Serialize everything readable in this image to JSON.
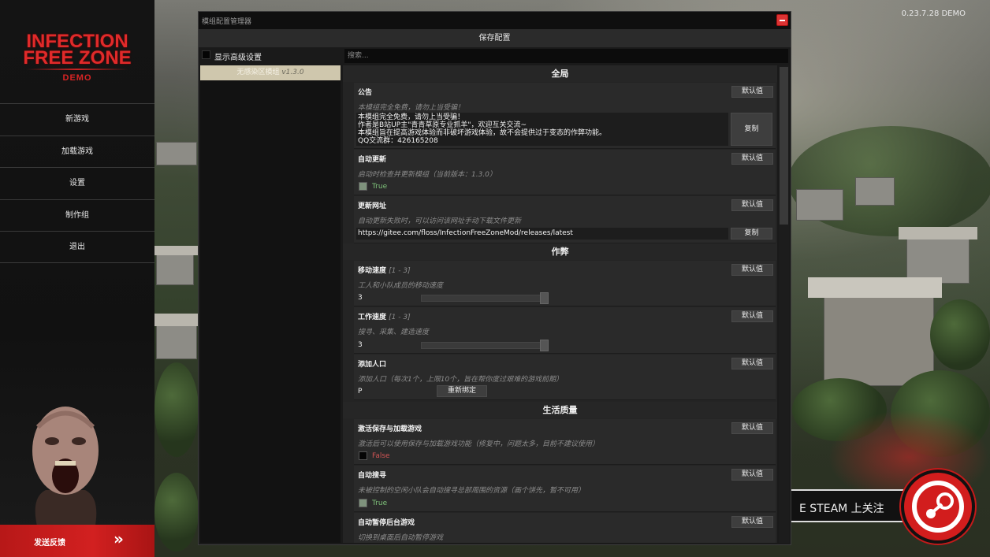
{
  "version": "0.23.7.28 DEMO",
  "logo": {
    "line1": "INFECTION",
    "line2": "FREE ZONE",
    "demo": "DEMO"
  },
  "menu": [
    "新游戏",
    "加载游戏",
    "设置",
    "制作组",
    "退出"
  ],
  "feedback": {
    "label": "发送反馈",
    "arrow": "»"
  },
  "steam": {
    "text": "E STEAM 上关注"
  },
  "window": {
    "title": "模组配置管理器",
    "save_label": "保存配置",
    "show_advanced": "显示高级设置",
    "search_placeholder": "搜索...",
    "mod": {
      "name": "无感染区模组",
      "version": "v1.3.0"
    }
  },
  "sections": {
    "global": "全局",
    "cheats": "作弊",
    "qol": "生活质量"
  },
  "labels": {
    "default": "默认值",
    "copy": "复制",
    "rebind": "重新绑定"
  },
  "settings": {
    "notice": {
      "title": "公告",
      "desc": "本模组完全免费，请勿上当受骗！",
      "text": "本模组完全免费，请勿上当受骗！\n作者是B站UP主\"青青草原专业抓羊\"，欢迎互关交流~\n本模组旨在提高游戏体验而非破坏游戏体验，故不会提供过于变态的作弊功能。\nQQ交流群：426165208"
    },
    "auto_update": {
      "title": "自动更新",
      "desc": "启动时检查并更新模组（当前版本：1.3.0）",
      "value": "True"
    },
    "update_url": {
      "title": "更新网址",
      "desc": "自动更新失败时，可以访问该网址手动下载文件更新",
      "value": "https://gitee.com/floss/InfectionFreeZoneMod/releases/latest"
    },
    "move_speed": {
      "title": "移动速度",
      "range": "[1 - 3]",
      "desc": "工人和小队成员的移动速度",
      "value": "3",
      "level": 1.0
    },
    "work_speed": {
      "title": "工作速度",
      "range": "[1 - 3]",
      "desc": "搜寻、采集、建造速度",
      "value": "3",
      "level": 1.0
    },
    "add_pop": {
      "title": "添加人口",
      "desc": "添加人口（每次1个，上限10个，旨在帮你度过艰难的游戏前期）",
      "value": "P"
    },
    "save_load": {
      "title": "激活保存与加载游戏",
      "desc": "激活后可以使用保存与加载游戏功能（修复中，问题太多，目前不建议使用）",
      "value": "False"
    },
    "auto_search": {
      "title": "自动搜寻",
      "desc": "未被控制的空闲小队会自动搜寻总部周围的资源（画个饼先，暂不可用）",
      "value": "True"
    },
    "auto_pause": {
      "title": "自动暂停后台游戏",
      "desc": "切换到桌面后自动暂停游戏"
    }
  }
}
